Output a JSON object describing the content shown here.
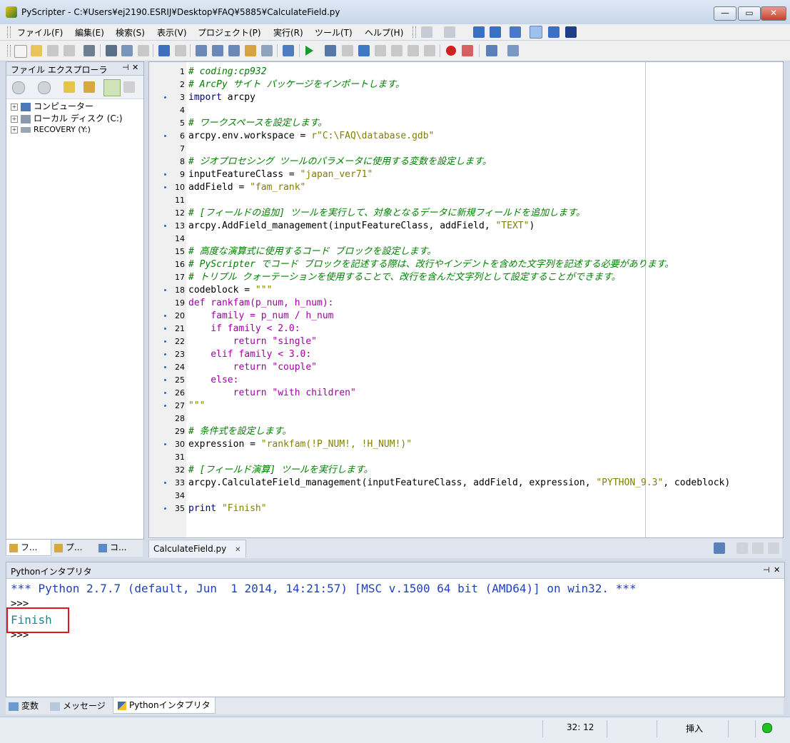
{
  "window": {
    "title": "PyScripter - C:¥Users¥ej2190.ESRIJ¥Desktop¥FAQ¥5885¥CalculateField.py",
    "minimize": "—",
    "maximize": "▭",
    "close": "✕"
  },
  "menu": [
    "ファイル(F)",
    "編集(E)",
    "検索(S)",
    "表示(V)",
    "プロジェクト(P)",
    "実行(R)",
    "ツール(T)",
    "ヘルプ(H)"
  ],
  "file_explorer": {
    "title": "ファイル エクスプローラ",
    "pin": "⊣",
    "close": "✕",
    "tree": [
      {
        "label": "コンピューター"
      },
      {
        "label": "ローカル ディスク (C:)"
      },
      {
        "label": "RECOVERY (Y:)"
      }
    ],
    "tabs": [
      "フ...",
      "プ...",
      "コ..."
    ]
  },
  "editor": {
    "tab_label": "CalculateField.py",
    "tab_close": "✕",
    "lines": [
      {
        "n": "1",
        "dot": false,
        "parts": [
          [
            "c",
            "# coding:cp932"
          ]
        ]
      },
      {
        "n": "2",
        "dot": false,
        "parts": [
          [
            "c",
            "# ArcPy サイト パッケージをインポートします。"
          ]
        ]
      },
      {
        "n": "3",
        "dot": true,
        "parts": [
          [
            "k",
            "import"
          ],
          [
            "p",
            " arcpy"
          ]
        ]
      },
      {
        "n": "4",
        "dot": false,
        "parts": []
      },
      {
        "n": "5",
        "dot": false,
        "parts": [
          [
            "c",
            "# ワークスペースを設定します。"
          ]
        ]
      },
      {
        "n": "6",
        "dot": true,
        "parts": [
          [
            "p",
            "arcpy.env.workspace = "
          ],
          [
            "s",
            "r\"C:\\FAQ\\database.gdb\""
          ]
        ]
      },
      {
        "n": "7",
        "dot": false,
        "parts": []
      },
      {
        "n": "8",
        "dot": false,
        "parts": [
          [
            "c",
            "# ジオプロセシング ツールのパラメータに使用する変数を設定します。"
          ]
        ]
      },
      {
        "n": "9",
        "dot": true,
        "parts": [
          [
            "p",
            "inputFeatureClass = "
          ],
          [
            "s",
            "\"japan_ver71\""
          ]
        ]
      },
      {
        "n": "10",
        "dot": true,
        "parts": [
          [
            "p",
            "addField = "
          ],
          [
            "s",
            "\"fam_rank\""
          ]
        ]
      },
      {
        "n": "11",
        "dot": false,
        "parts": []
      },
      {
        "n": "12",
        "dot": false,
        "parts": [
          [
            "c",
            "# [フィールドの追加] ツールを実行して、対象となるデータに新規フィールドを追加します。"
          ]
        ]
      },
      {
        "n": "13",
        "dot": true,
        "parts": [
          [
            "p",
            "arcpy.AddField_management(inputFeatureClass, addField, "
          ],
          [
            "s",
            "\"TEXT\""
          ],
          [
            "p",
            ")"
          ]
        ]
      },
      {
        "n": "14",
        "dot": false,
        "parts": []
      },
      {
        "n": "15",
        "dot": false,
        "parts": [
          [
            "c",
            "# 高度な演算式に使用するコード ブロックを設定します。"
          ]
        ]
      },
      {
        "n": "16",
        "dot": false,
        "parts": [
          [
            "c",
            "# PyScripter でコード ブロックを記述する際は、改行やインデントを含めた文字列を記述する必要があります。"
          ]
        ]
      },
      {
        "n": "17",
        "dot": false,
        "parts": [
          [
            "c",
            "# トリプル クォーテーションを使用することで、改行を含んだ文字列として設定することができます。"
          ]
        ]
      },
      {
        "n": "18",
        "dot": true,
        "parts": [
          [
            "p",
            "codeblock = "
          ],
          [
            "s",
            "\"\"\""
          ]
        ]
      },
      {
        "n": "19",
        "dot": false,
        "parts": [
          [
            "d",
            "def rankfam(p_num, h_num):"
          ]
        ]
      },
      {
        "n": "20",
        "dot": true,
        "parts": [
          [
            "d",
            "    family = p_num / h_num"
          ]
        ]
      },
      {
        "n": "21",
        "dot": true,
        "parts": [
          [
            "d",
            "    if family < 2.0:"
          ]
        ]
      },
      {
        "n": "22",
        "dot": true,
        "parts": [
          [
            "d",
            "        return \"single\""
          ]
        ]
      },
      {
        "n": "23",
        "dot": true,
        "parts": [
          [
            "d",
            "    elif family < 3.0:"
          ]
        ]
      },
      {
        "n": "24",
        "dot": true,
        "parts": [
          [
            "d",
            "        return \"couple\""
          ]
        ]
      },
      {
        "n": "25",
        "dot": true,
        "parts": [
          [
            "d",
            "    else:"
          ]
        ]
      },
      {
        "n": "26",
        "dot": true,
        "parts": [
          [
            "d",
            "        return \"with children\""
          ]
        ]
      },
      {
        "n": "27",
        "dot": true,
        "parts": [
          [
            "s",
            "\"\"\""
          ]
        ]
      },
      {
        "n": "28",
        "dot": false,
        "parts": []
      },
      {
        "n": "29",
        "dot": false,
        "parts": [
          [
            "c",
            "# 条件式を設定します。"
          ]
        ]
      },
      {
        "n": "30",
        "dot": true,
        "parts": [
          [
            "p",
            "expression = "
          ],
          [
            "s",
            "\"rankfam(!P_NUM!, !H_NUM!)\""
          ]
        ]
      },
      {
        "n": "31",
        "dot": false,
        "parts": []
      },
      {
        "n": "32",
        "dot": false,
        "parts": [
          [
            "c",
            "# [フィールド演算] ツールを実行します。"
          ]
        ]
      },
      {
        "n": "33",
        "dot": true,
        "parts": [
          [
            "p",
            "arcpy.CalculateField_management(inputFeatureClass, addField, expression, "
          ],
          [
            "s",
            "\"PYTHON_9.3\""
          ],
          [
            "p",
            ", codeblock)"
          ]
        ]
      },
      {
        "n": "34",
        "dot": false,
        "parts": []
      },
      {
        "n": "35",
        "dot": true,
        "parts": [
          [
            "k",
            "print"
          ],
          [
            "p",
            " "
          ],
          [
            "s",
            "\"Finish\""
          ]
        ]
      }
    ]
  },
  "interpreter": {
    "title": "Pythonインタプリタ",
    "pin": "⊣",
    "close": "✕",
    "banner": "*** Python 2.7.7 (default, Jun  1 2014, 14:21:57) [MSC v.1500 64 bit (AMD64)] on win32. ***",
    "prompt1": ">>>",
    "output": "Finish",
    "prompt2": ">>>"
  },
  "bottom_tabs": [
    "変数",
    "メッセージ",
    "Pythonインタプリタ"
  ],
  "status": {
    "position": "32: 12",
    "mode": "挿入"
  },
  "colors": {
    "banner": "#1f3fbf",
    "output": "#1a8a8a",
    "highlight": "#e0161f",
    "status_ok": "#22c022"
  }
}
